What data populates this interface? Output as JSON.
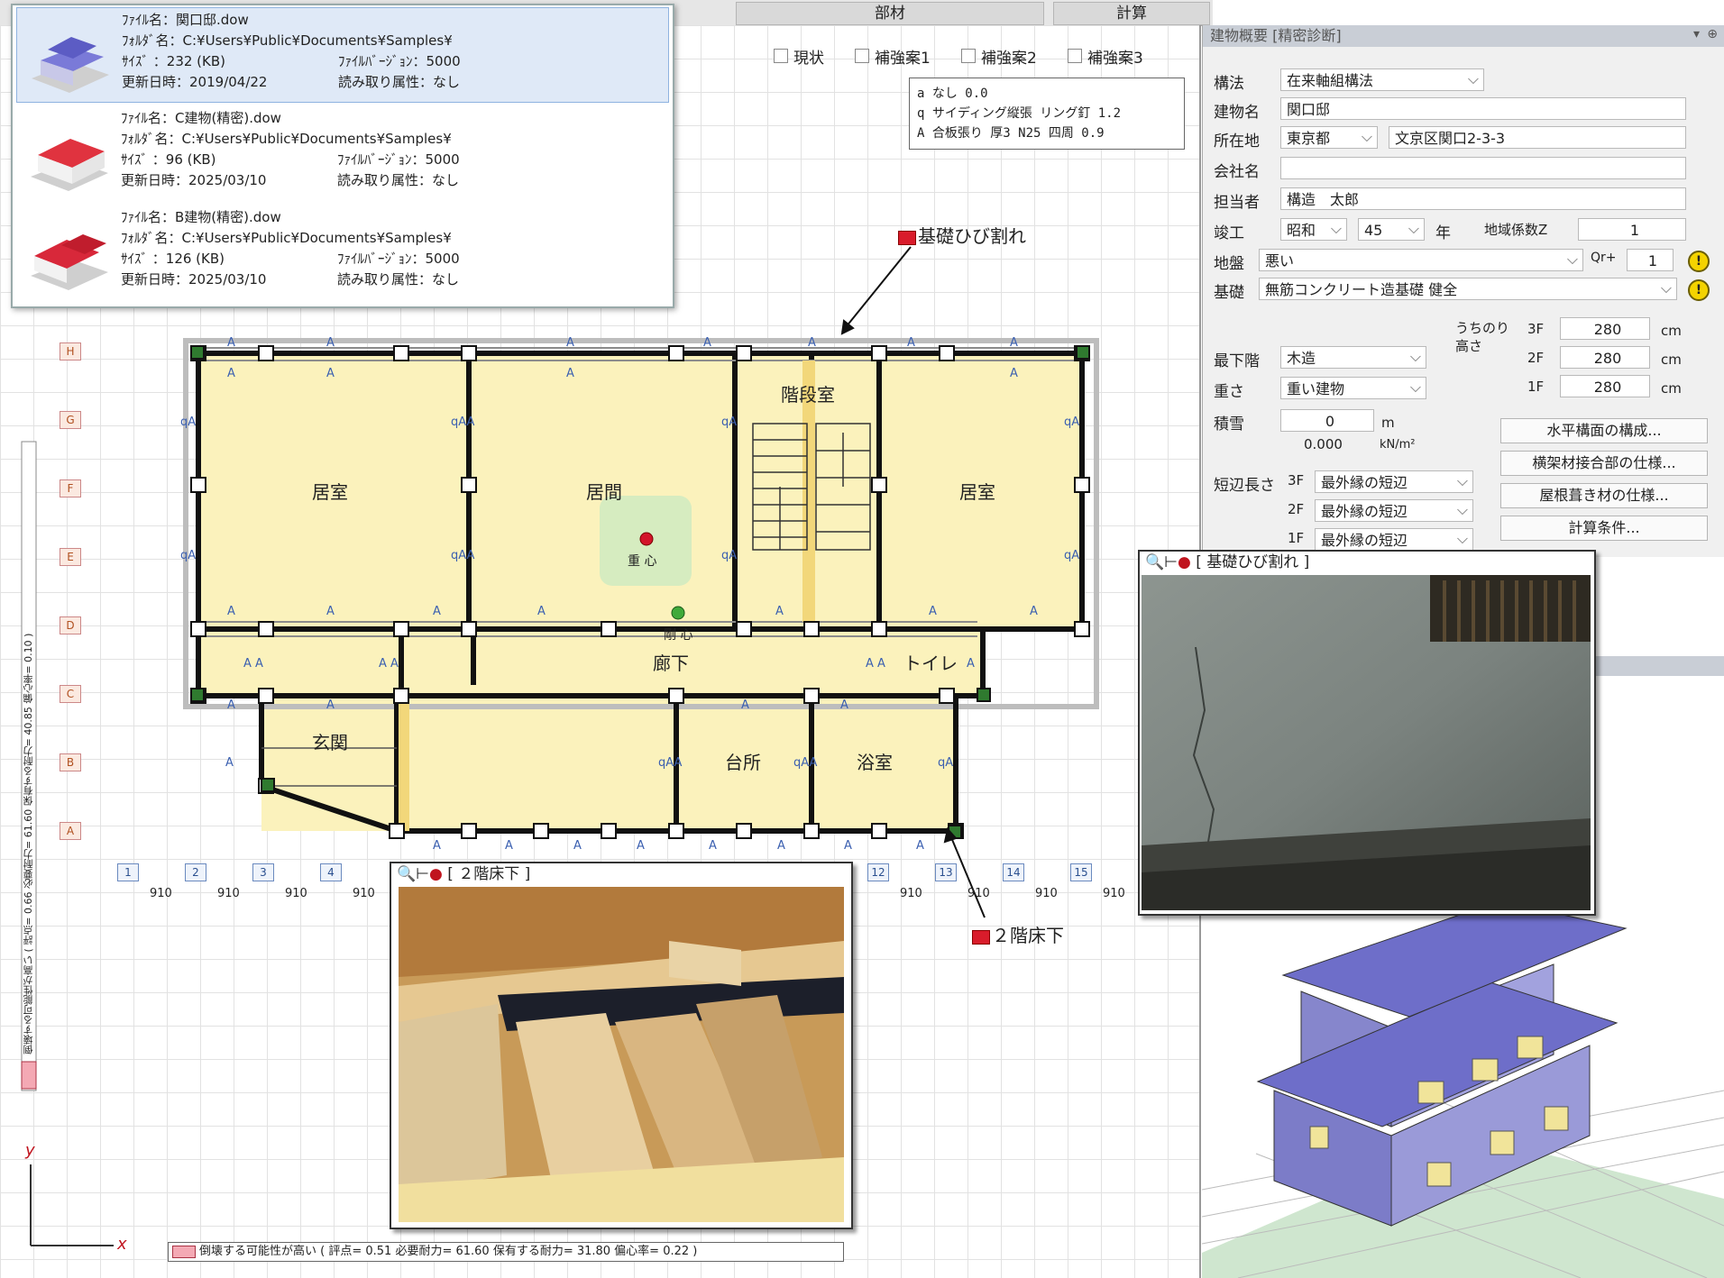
{
  "tabs": [
    "部材",
    "計算"
  ],
  "plan_toggles": [
    "現状",
    "補強案1",
    "補強案2",
    "補強案3"
  ],
  "recent_files": [
    {
      "name_label": "ﾌｧｲﾙ名：",
      "name": "関口邸.dow",
      "folder_label": "ﾌｫﾙﾀﾞ名：",
      "folder": "C:¥Users¥Public¥Documents¥Samples¥",
      "size_label": "ｻｲｽﾞ ：",
      "size": "232 (KB)",
      "version_label": "ﾌｧｲﾙﾊﾞｰｼﾞｮﾝ：",
      "version": "5000",
      "date_label": "更新日時：",
      "date": "2019/04/22",
      "attr_label": "読み取り属性：",
      "attr": "なし"
    },
    {
      "name_label": "ﾌｧｲﾙ名：",
      "name": "C建物(精密).dow",
      "folder_label": "ﾌｫﾙﾀﾞ名：",
      "folder": "C:¥Users¥Public¥Documents¥Samples¥",
      "size_label": "ｻｲｽﾞ ：",
      "size": "96 (KB)",
      "version_label": "ﾌｧｲﾙﾊﾞｰｼﾞｮﾝ：",
      "version": "5000",
      "date_label": "更新日時：",
      "date": "2025/03/10",
      "attr_label": "読み取り属性：",
      "attr": "なし"
    },
    {
      "name_label": "ﾌｧｲﾙ名：",
      "name": "B建物(精密).dow",
      "folder_label": "ﾌｫﾙﾀﾞ名：",
      "folder": "C:¥Users¥Public¥Documents¥Samples¥",
      "size_label": "ｻｲｽﾞ ：",
      "size": "126 (KB)",
      "version_label": "ﾌｧｲﾙﾊﾞｰｼﾞｮﾝ：",
      "version": "5000",
      "date_label": "更新日時：",
      "date": "2025/03/10",
      "attr_label": "読み取り属性：",
      "attr": "なし"
    }
  ],
  "legend": [
    "a なし 0.0",
    "q サイディング縦張 リング釘 1.2",
    "A 合板張り 厚3 N25 四周 0.9"
  ],
  "rooms": [
    "居室",
    "居間",
    "階段室",
    "居室",
    "廊下",
    "トイレ",
    "玄関",
    "台所",
    "浴室"
  ],
  "gravity_label": "重 心",
  "eccentric_label": "剛 心",
  "grid_numbers": [
    "1",
    "2",
    "3",
    "4",
    "12",
    "13",
    "14",
    "15"
  ],
  "grid_letters": [
    "H",
    "G",
    "F",
    "E",
    "D",
    "C",
    "B",
    "A"
  ],
  "dim_value": "910",
  "callouts": {
    "foundation": "基礎ひび割れ",
    "floor": "２階床下"
  },
  "photo_windows": {
    "foundation": "[ 基礎ひび割れ ]",
    "floor": "[ ２階床下 ]"
  },
  "panel": {
    "header": "建物概要 [精密診断]",
    "structure_label": "構法",
    "structure": "在来軸組構法",
    "building_label": "建物名",
    "building": "関口邸",
    "address_label": "所在地",
    "pref": "東京都",
    "address": "文京区関口2-3-3",
    "company_label": "会社名",
    "company": "",
    "person_label": "担当者",
    "person": "構造　太郎",
    "built_label": "竣工",
    "era": "昭和",
    "year": "45",
    "year_unit": "年",
    "zone_label": "地域係数Z",
    "zone": "1",
    "ground_label": "地盤",
    "ground": "悪い",
    "qr_label": "Qr+",
    "qr": "1",
    "foundation_label": "基礎",
    "foundation": "無筋コンクリート造基礎 健全",
    "lowest_label": "最下階",
    "lowest": "木造",
    "weight_label": "重さ",
    "weight": "重い建物",
    "snow_label": "積雪",
    "snow_m": "0",
    "snow_m_unit": "m",
    "snow_kn": "0.000",
    "snow_kn_unit": "kN/m²",
    "height_label": "うちのり高さ",
    "heights": [
      {
        "floor": "3F",
        "value": "280",
        "unit": "cm"
      },
      {
        "floor": "2F",
        "value": "280",
        "unit": "cm"
      },
      {
        "floor": "1F",
        "value": "280",
        "unit": "cm"
      }
    ],
    "edge_label": "短辺長さ",
    "edges": [
      {
        "floor": "3F",
        "value": "最外縁の短辺"
      },
      {
        "floor": "2F",
        "value": "最外縁の短辺"
      },
      {
        "floor": "1F",
        "value": "最外縁の短辺"
      }
    ],
    "buttons": [
      "水平構面の構成...",
      "横架材接合部の仕様...",
      "屋根葺き材の仕様...",
      "計算条件..."
    ]
  },
  "status_bottom": "倒壊する可能性が高い ( 評点= 0.51  必要耐力= 61.60  保有する耐力= 31.80  偏心率= 0.22 )",
  "status_side": "倒壊する可能性が高い ( 評点= 0.66  必要耐力= 61.60  保有する耐力= 40.85  偏心率= 0.10 )",
  "axes": {
    "x": "x",
    "y": "y"
  },
  "colors": {
    "room_fill": "#fbf2bc",
    "wall": "#111111",
    "roof": "#6e6ec9",
    "grid": "#e2e2e2"
  }
}
